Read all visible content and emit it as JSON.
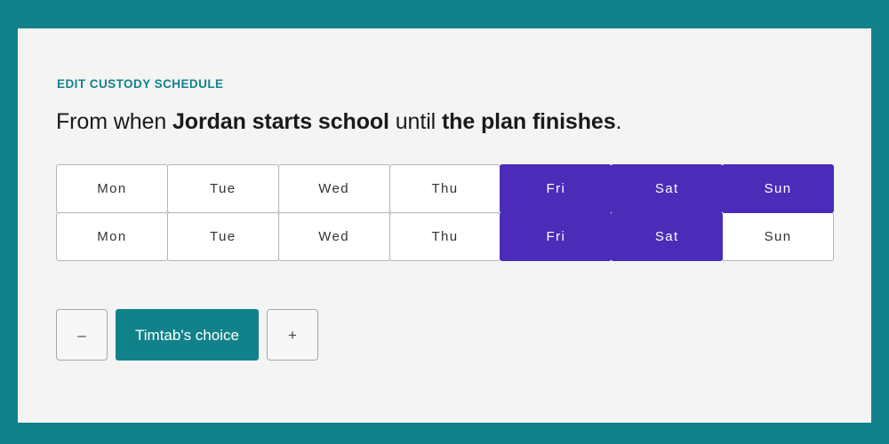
{
  "theme": {
    "frame_color": "#12828a",
    "card_color": "#f4f4f4",
    "accent_color": "#12828a",
    "selected_color": "#4b2cb8",
    "cell_color": "#ffffff",
    "text_color": "#1a1a1a"
  },
  "header": {
    "eyebrow": "EDIT CUSTODY SCHEDULE",
    "headline": {
      "part1": "From when ",
      "strong1": "Jordan starts school",
      "part2": " until ",
      "strong2": "the plan finishes",
      "part3": "."
    }
  },
  "schedule": {
    "rows": [
      {
        "cells": [
          {
            "label": "Mon",
            "selected": false
          },
          {
            "label": "Tue",
            "selected": false
          },
          {
            "label": "Wed",
            "selected": false
          },
          {
            "label": "Thu",
            "selected": false
          },
          {
            "label": "Fri",
            "selected": true
          },
          {
            "label": "Sat",
            "selected": true
          },
          {
            "label": "Sun",
            "selected": true
          }
        ]
      },
      {
        "cells": [
          {
            "label": "Mon",
            "selected": false
          },
          {
            "label": "Tue",
            "selected": false
          },
          {
            "label": "Wed",
            "selected": false
          },
          {
            "label": "Thu",
            "selected": false
          },
          {
            "label": "Fri",
            "selected": true
          },
          {
            "label": "Sat",
            "selected": true
          },
          {
            "label": "Sun",
            "selected": false
          }
        ]
      }
    ]
  },
  "controls": {
    "decrement_label": "–",
    "primary_label": "Timtab's choice",
    "increment_label": "+"
  }
}
